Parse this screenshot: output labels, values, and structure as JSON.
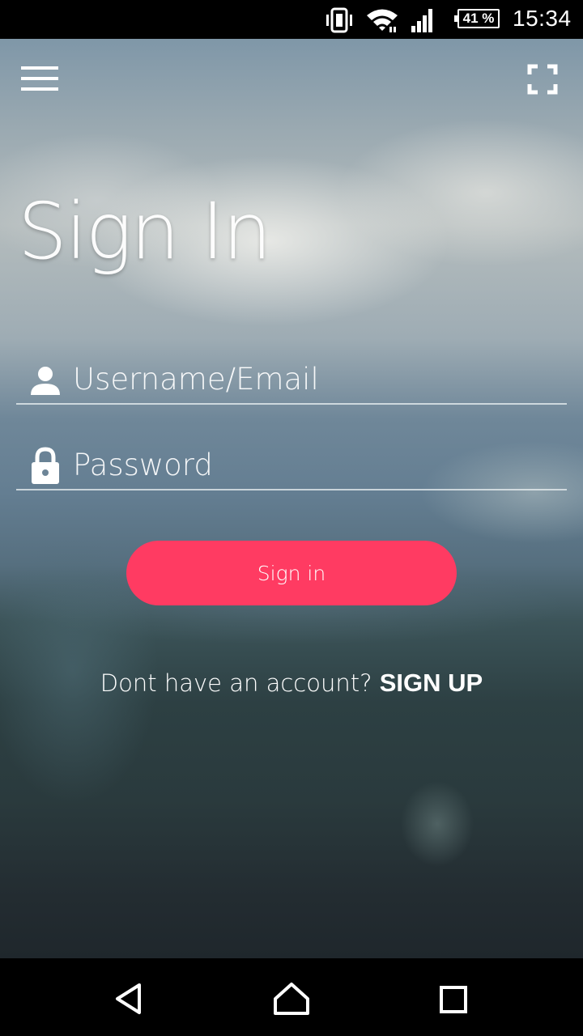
{
  "status_bar": {
    "battery": "41 %",
    "time": "15:34",
    "icons": [
      "vibrate-icon",
      "wifi-icon",
      "signal-icon",
      "battery-icon"
    ]
  },
  "toolbar": {
    "menu_icon": "hamburger-menu-icon",
    "fullscreen_icon": "fullscreen-icon"
  },
  "page": {
    "title": "Sign In"
  },
  "form": {
    "username": {
      "placeholder": "Username/Email",
      "value": "",
      "icon": "person-icon"
    },
    "password": {
      "placeholder": "Password",
      "value": "",
      "icon": "lock-icon"
    },
    "submit_label": "Sign in"
  },
  "signup": {
    "prompt": "Dont have an account?",
    "link_label": "SIGN UP"
  },
  "nav_bar": {
    "icons": [
      "back-icon",
      "home-icon",
      "recents-icon"
    ]
  },
  "colors": {
    "accent": "#ff3b62",
    "text": "#ffffff",
    "status_bar": "#000000"
  }
}
